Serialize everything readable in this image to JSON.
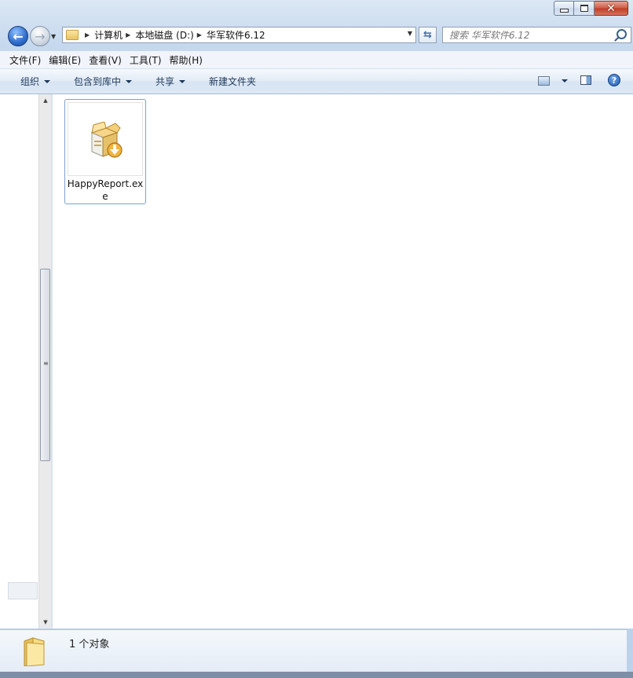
{
  "window": {
    "caption": {
      "minimize": "minimize",
      "maximize": "maximize",
      "close": "✕"
    }
  },
  "nav": {
    "back_glyph": "←",
    "forward_glyph": "→"
  },
  "address": {
    "crumbs": [
      "计算机",
      "本地磁盘 (D:)",
      "华军软件6.12"
    ]
  },
  "search": {
    "placeholder": "搜索 华军软件6.12"
  },
  "menubar": {
    "items": [
      "文件(F)",
      "编辑(E)",
      "查看(V)",
      "工具(T)",
      "帮助(H)"
    ]
  },
  "toolbar": {
    "organize": "组织",
    "include_in_library": "包含到库中",
    "share": "共享",
    "new_folder": "新建文件夹",
    "help_glyph": "?"
  },
  "files": [
    {
      "name": "HappyReport.exe",
      "icon": "installer-box-icon"
    }
  ],
  "status": {
    "item_count": "1 个对象"
  },
  "colors": {
    "accent": "#1e395b",
    "selection_border": "#7da2ce",
    "window_frame": "#bcd2ea"
  }
}
